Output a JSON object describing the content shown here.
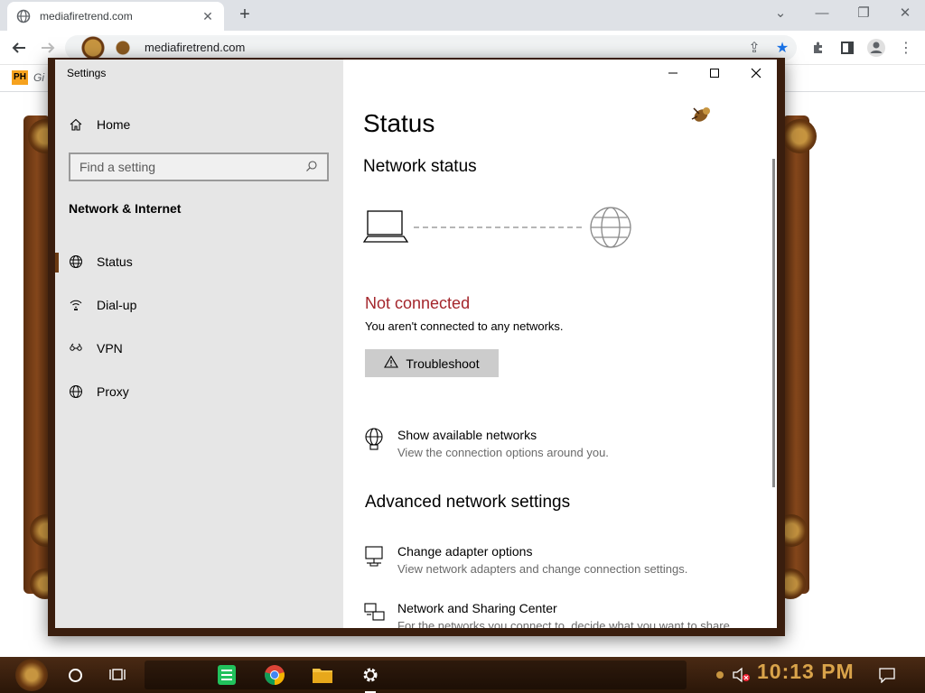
{
  "browser": {
    "tab_title": "mediafiretrend.com",
    "url": "mediafiretrend.com",
    "bookmark_badge": "PH",
    "bookmark_label": "Gi"
  },
  "settings_window": {
    "title": "Settings",
    "sidebar": {
      "home_label": "Home",
      "search_placeholder": "Find a setting",
      "section_label": "Network & Internet",
      "items": [
        {
          "label": "Status",
          "icon": "globe-icon",
          "active": true
        },
        {
          "label": "Dial-up",
          "icon": "phone-icon",
          "active": false
        },
        {
          "label": "VPN",
          "icon": "vpn-icon",
          "active": false
        },
        {
          "label": "Proxy",
          "icon": "globe-icon",
          "active": false
        }
      ]
    },
    "main": {
      "page_title": "Status",
      "network_status_heading": "Network status",
      "connection_state": "Not connected",
      "connection_desc": "You aren't connected to any networks.",
      "troubleshoot_label": "Troubleshoot",
      "show_networks": {
        "title": "Show available networks",
        "desc": "View the connection options around you."
      },
      "advanced_heading": "Advanced network settings",
      "adapter_options": {
        "title": "Change adapter options",
        "desc": "View network adapters and change connection settings."
      },
      "sharing_center": {
        "title": "Network and Sharing Center",
        "desc": "For the networks you connect to, decide what you want to share."
      }
    }
  },
  "taskbar": {
    "clock": "10:13 PM"
  },
  "colors": {
    "error_red": "#a4262c",
    "frame_brown": "#3a1e0e",
    "clock_gold": "#d9a34a"
  }
}
